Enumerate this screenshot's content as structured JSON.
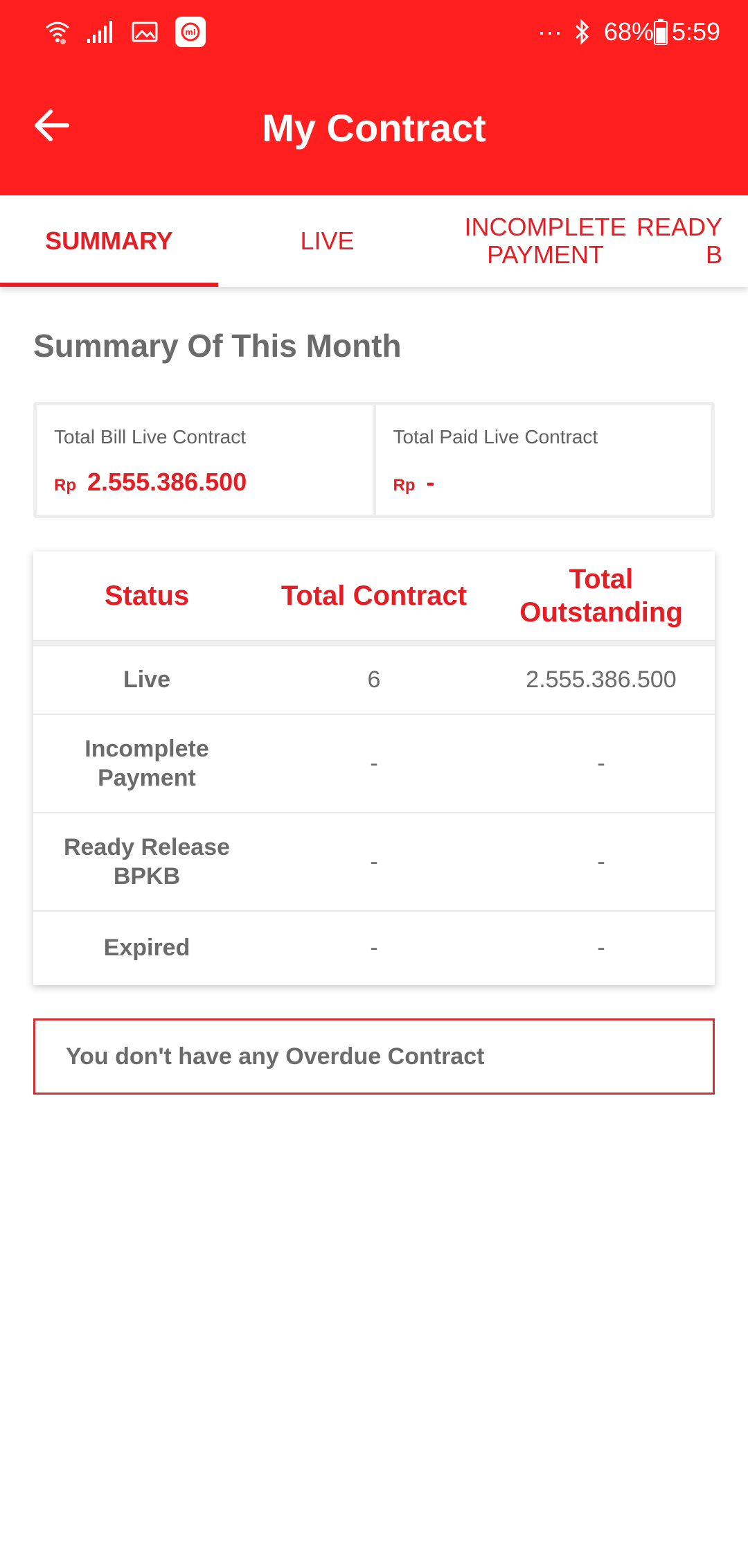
{
  "status_bar": {
    "battery": "68%",
    "time": "5:59",
    "dots": "···",
    "icons": [
      "wifi-icon",
      "signal-icon",
      "gallery-icon",
      "mi-app-icon",
      "bluetooth-icon",
      "battery-icon"
    ]
  },
  "app_bar": {
    "title": "My Contract",
    "back_icon": "arrow-left-icon"
  },
  "tabs": [
    {
      "label": "SUMMARY",
      "active": true
    },
    {
      "label": "LIVE",
      "active": false
    },
    {
      "label": "INCOMPLETE\nPAYMENT",
      "active": false
    },
    {
      "label": "READY\nB",
      "active": false
    }
  ],
  "summary": {
    "title": "Summary Of This Month",
    "total_bill": {
      "label": "Total Bill Live Contract",
      "currency": "Rp",
      "value": "2.555.386.500"
    },
    "total_paid": {
      "label": "Total Paid Live Contract",
      "currency": "Rp",
      "value": "-"
    }
  },
  "table": {
    "headers": [
      "Status",
      "Total Contract",
      "Total\nOutstanding"
    ],
    "rows": [
      {
        "status": "Live",
        "total_contract": "6",
        "total_outstanding": "2.555.386.500"
      },
      {
        "status": "Incomplete\nPayment",
        "total_contract": "-",
        "total_outstanding": "-"
      },
      {
        "status": "Ready Release\nBPKB",
        "total_contract": "-",
        "total_outstanding": "-"
      },
      {
        "status": "Expired",
        "total_contract": "-",
        "total_outstanding": "-"
      }
    ]
  },
  "overdue_message": "You don't have any Overdue Contract",
  "colors": {
    "primary": "#ff1f1f",
    "accent_text": "#e31e24",
    "muted_text": "#6b6b6b",
    "border": "#eeeeee"
  }
}
